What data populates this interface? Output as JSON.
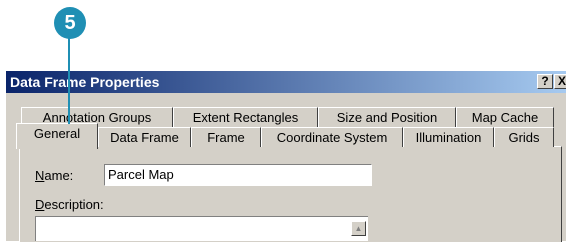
{
  "callout": {
    "number": "5"
  },
  "dialog": {
    "title": "Data Frame Properties",
    "help_label": "?",
    "close_label": "X",
    "tabs_row1": [
      "Annotation Groups",
      "Extent Rectangles",
      "Size and Position",
      "Map Cache"
    ],
    "tabs_row2": [
      "General",
      "Data Frame",
      "Frame",
      "Coordinate System",
      "Illumination",
      "Grids"
    ],
    "active_tab": "General"
  },
  "general": {
    "name_label_prefix": "N",
    "name_label_rest": "ame:",
    "name_value": "Parcel Map",
    "description_label_prefix": "D",
    "description_label_rest": "escription:",
    "scroll_up_glyph": "▲"
  },
  "icons": {
    "help": "question-mark-icon",
    "close": "close-icon",
    "scroll_up": "scroll-up-arrow-icon"
  }
}
